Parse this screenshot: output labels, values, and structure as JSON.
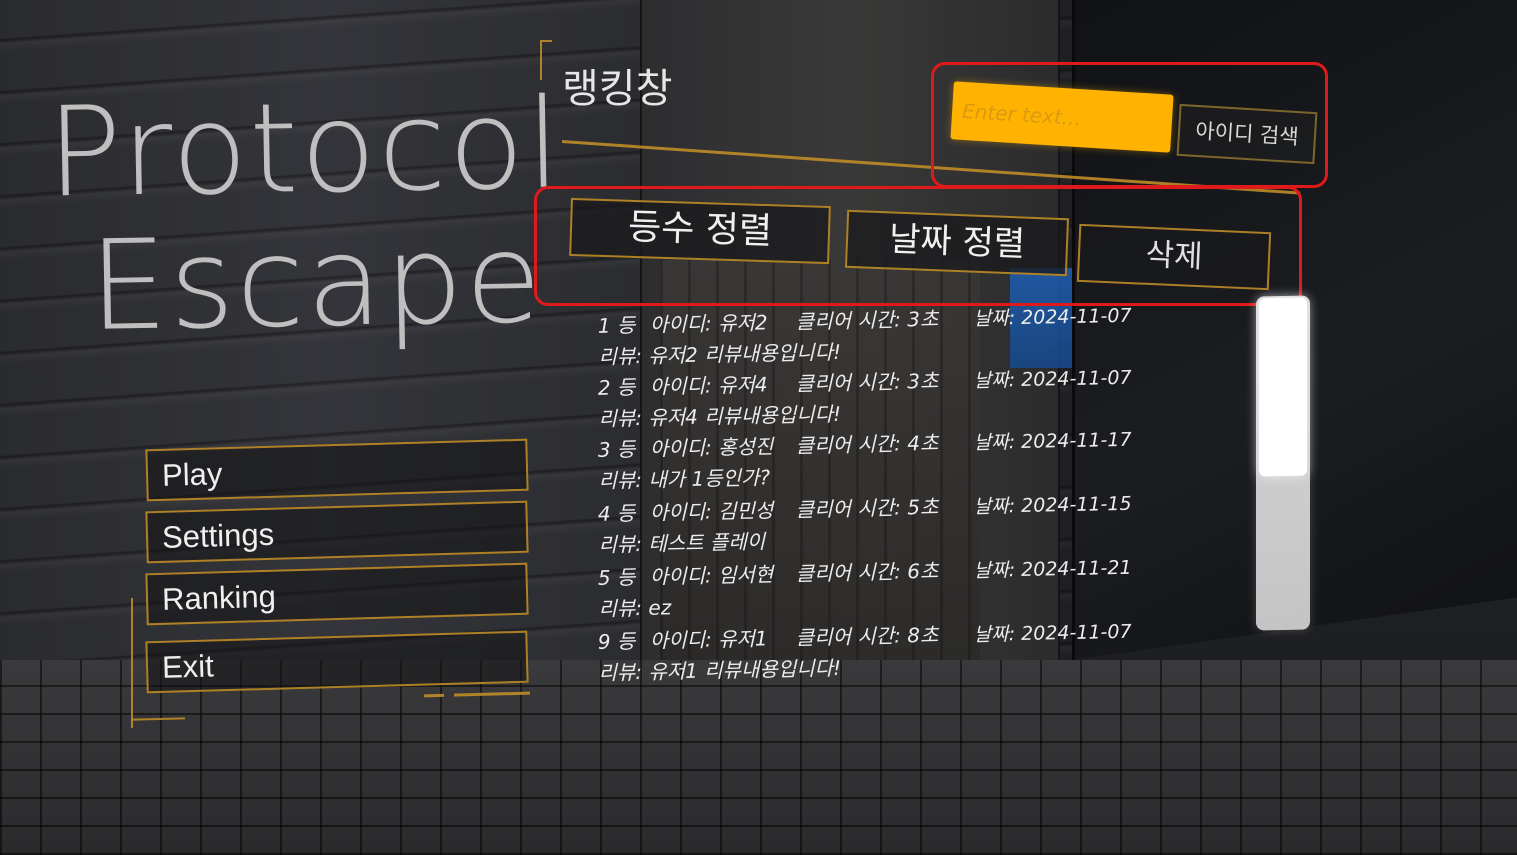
{
  "game": {
    "title_line1": "Protocol",
    "title_line2": "Escape"
  },
  "main_menu": {
    "items": [
      {
        "label": "Play"
      },
      {
        "label": "Settings"
      },
      {
        "label": "Ranking"
      },
      {
        "label": "Exit"
      }
    ]
  },
  "ranking_panel": {
    "title": "랭킹창",
    "search": {
      "placeholder": "Enter text...",
      "button_label": "아이디 검색"
    },
    "sort_buttons": {
      "by_rank": "등수 정렬",
      "by_date": "날짜 정렬",
      "delete": "삭제"
    },
    "entries": [
      {
        "rank": "1 등",
        "id": "아이디: 유저2",
        "clear_time": "클리어 시간: 3초",
        "date": "날짜: 2024-11-07",
        "review": "리뷰: 유저2 리뷰내용입니다!"
      },
      {
        "rank": "2 등",
        "id": "아이디: 유저4",
        "clear_time": "클리어 시간: 3초",
        "date": "날짜: 2024-11-07",
        "review": "리뷰: 유저4 리뷰내용입니다!"
      },
      {
        "rank": "3 등",
        "id": "아이디: 홍성진",
        "clear_time": "클리어 시간: 4초",
        "date": "날짜: 2024-11-17",
        "review": "리뷰: 내가 1등인가?"
      },
      {
        "rank": "4 등",
        "id": "아이디: 김민성",
        "clear_time": "클리어 시간: 5초",
        "date": "날짜: 2024-11-15",
        "review": "리뷰: 테스트 플레이"
      },
      {
        "rank": "5 등",
        "id": "아이디: 임서현",
        "clear_time": "클리어 시간: 6초",
        "date": "날짜: 2024-11-21",
        "review": "리뷰: ez"
      },
      {
        "rank": "9 등",
        "id": "아이디: 유저1",
        "clear_time": "클리어 시간: 8초",
        "date": "날짜: 2024-11-07",
        "review": "리뷰: 유저1 리뷰내용입니다!"
      }
    ],
    "scroll_position": 0.0
  },
  "colors": {
    "accent_gold": "#be8c28",
    "search_field": "#ffb300",
    "highlight_red": "#e01a1a"
  }
}
